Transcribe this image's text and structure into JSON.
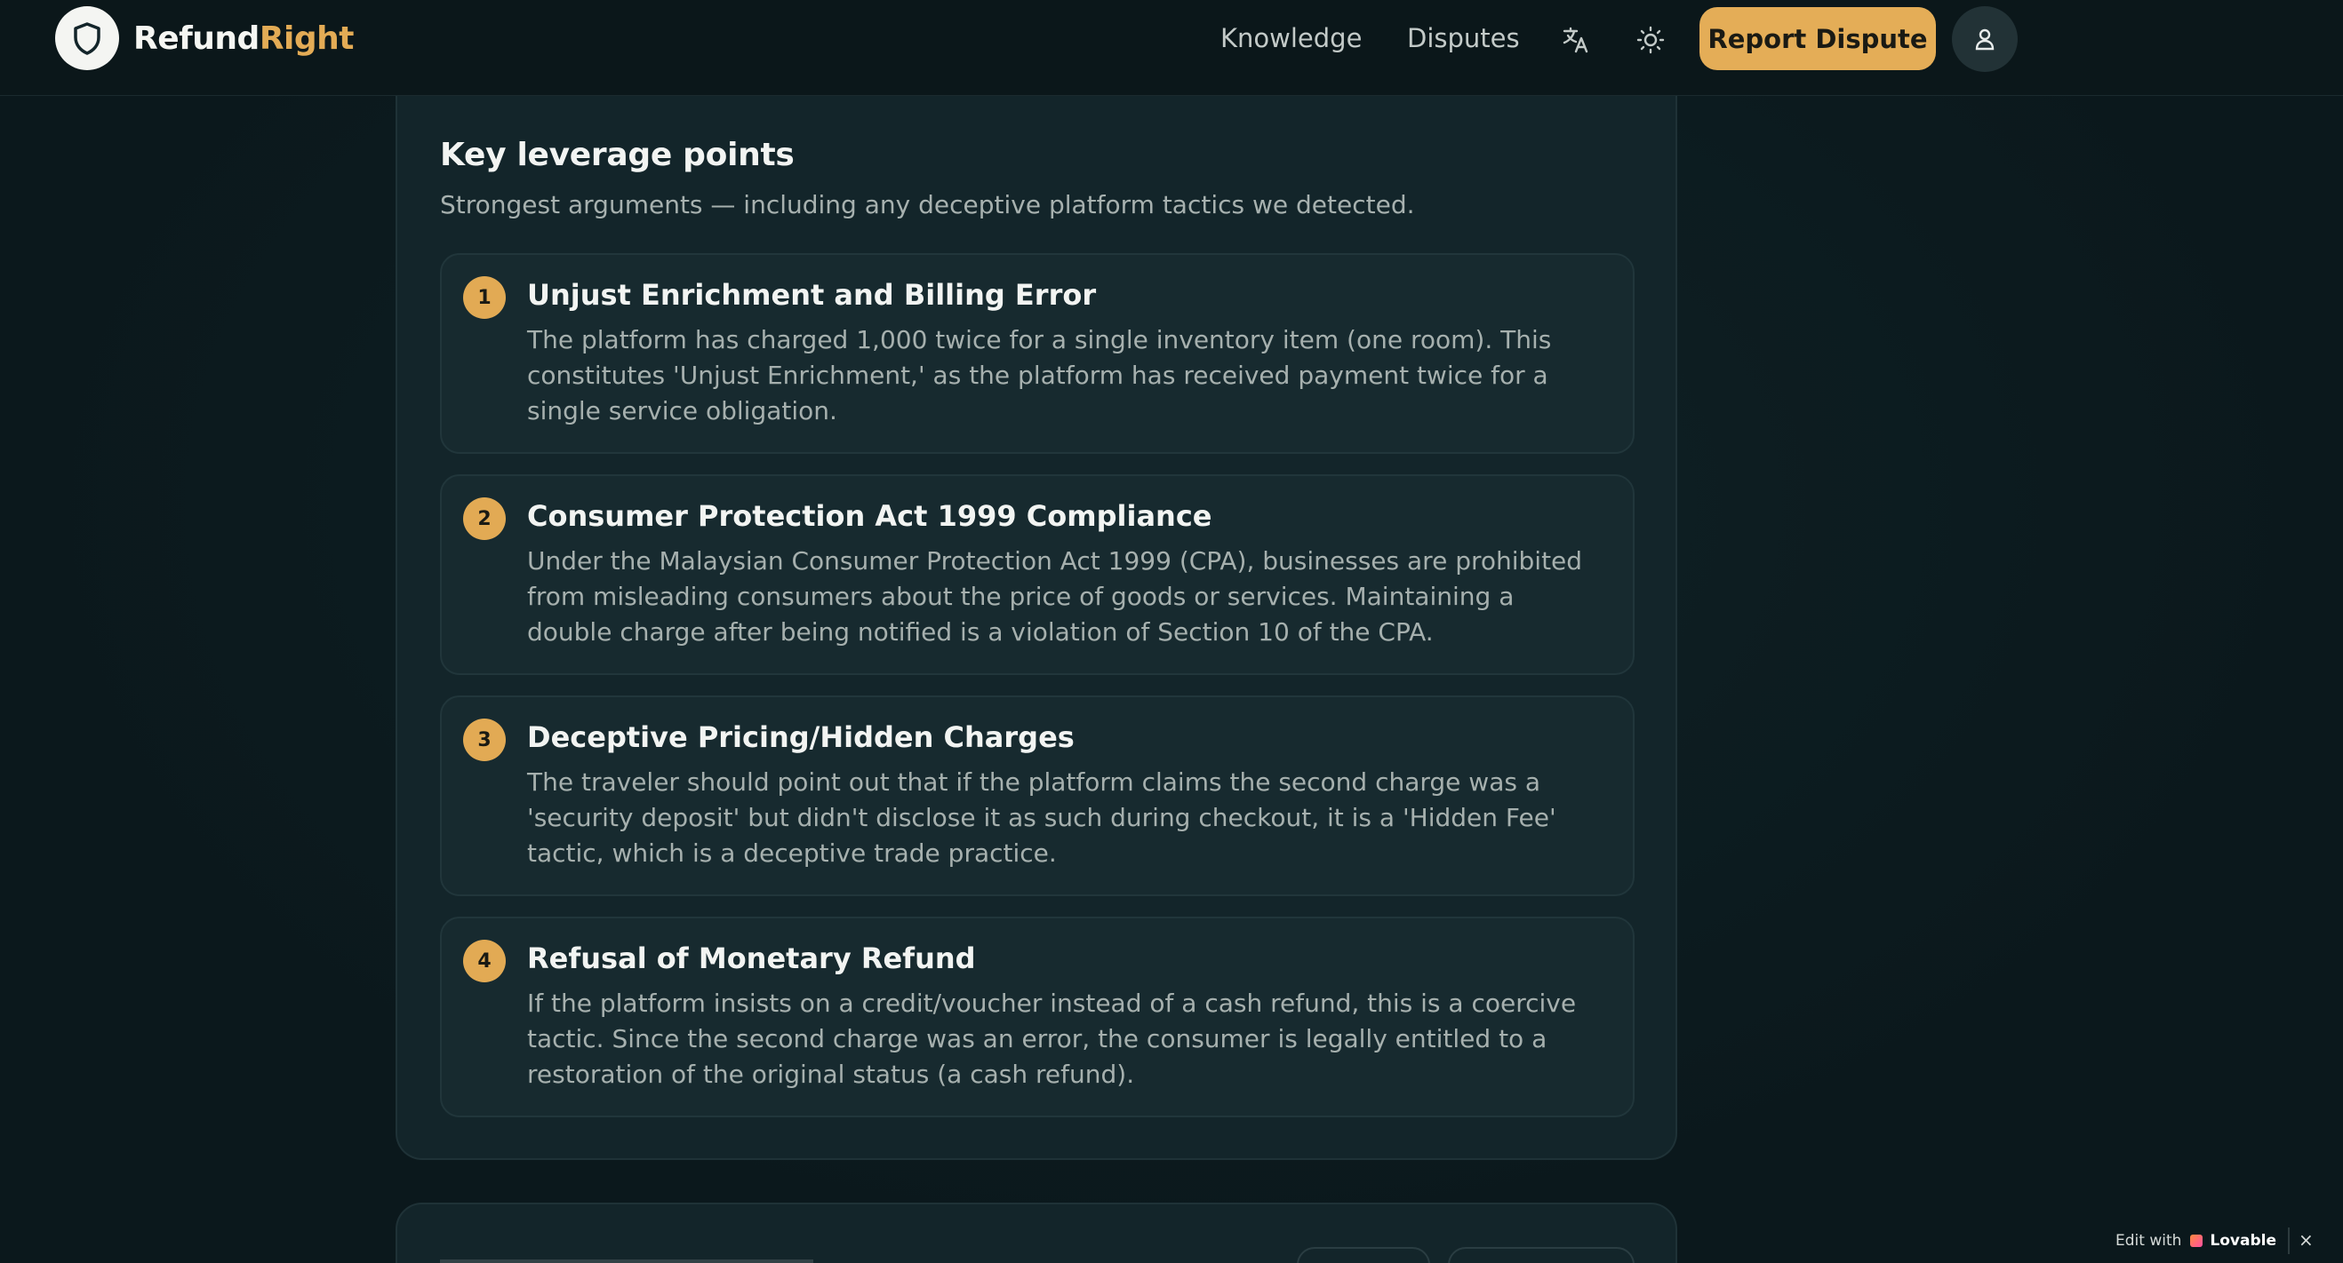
{
  "header": {
    "brand_part1": "Refund",
    "brand_part2": "Right",
    "nav": [
      "Knowledge",
      "Disputes"
    ],
    "report_button": "Report Dispute",
    "icons": [
      "shield-logo-icon",
      "translate-icon",
      "sun-icon",
      "user-icon"
    ]
  },
  "leverage": {
    "title": "Key leverage points",
    "subtitle": "Strongest arguments — including any deceptive platform tactics we detected.",
    "points": [
      {
        "number": "1",
        "title": "Unjust Enrichment and Billing Error",
        "body": "The platform has charged 1,000 twice for a single inventory item (one room). This constitutes 'Unjust Enrichment,' as the platform has received payment twice for a single service obligation."
      },
      {
        "number": "2",
        "title": "Consumer Protection Act 1999 Compliance",
        "body": "Under the Malaysian Consumer Protection Act 1999 (CPA), businesses are prohibited from misleading consumers about the price of goods or services. Maintaining a double charge after being notified is a violation of Section 10 of the CPA."
      },
      {
        "number": "3",
        "title": "Deceptive Pricing/Hidden Charges",
        "body": "The traveler should point out that if the platform claims the second charge was a 'security deposit' but didn't disclose it as such during checkout, it is a 'Hidden Fee' tactic, which is a deceptive trade practice."
      },
      {
        "number": "4",
        "title": "Refusal of Monetary Refund",
        "body": "If the platform insists on a credit/voucher instead of a cash refund, this is a coercive tactic. Since the second charge was an error, the consumer is legally entitled to a restoration of the original status (a cash refund)."
      }
    ]
  },
  "lovable_badge": {
    "prefix": "Edit with",
    "brand": "Lovable",
    "close": "×"
  },
  "colors": {
    "accent": "#e4ad57",
    "background": "#0d1b1f",
    "card": "#13252a"
  }
}
